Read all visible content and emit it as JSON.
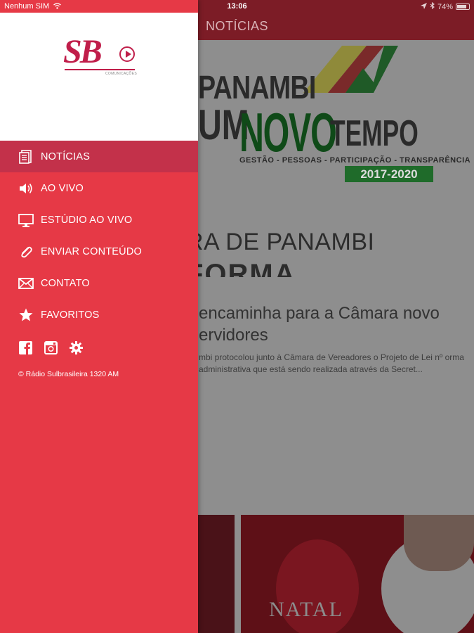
{
  "status_bar": {
    "carrier": "Nenhum SIM",
    "time": "13:06",
    "battery": "74%"
  },
  "app_bar": {
    "title": "NOTÍCIAS"
  },
  "background": {
    "banner": {
      "line1": "PANAMBI",
      "line2_a": "UM",
      "line2_b": "NOVO",
      "line2_c": "TEMPO",
      "subtitle": "GESTÃO - PESSOAS - PARTICIPAÇÃO - TRANSPARÊNCIA",
      "years": "2017-2020"
    },
    "headline_image_text": "RA DE PANAMBI",
    "headline_image_text2": "FORMA",
    "article": {
      "title": "encaminha para a Câmara novo ervidores",
      "excerpt": "mbi protocolou junto à Câmara de Vereadores o Projeto de Lei nº orma administrativa que está sendo realizada através da Secret..."
    },
    "second_image_text": "NATAL"
  },
  "drawer": {
    "logo": {
      "text": "SB",
      "subtitle": "COMUNICAÇÕES"
    },
    "menu": [
      {
        "label": "NOTÍCIAS",
        "icon": "news-icon",
        "active": true
      },
      {
        "label": "AO VIVO",
        "icon": "speaker-icon",
        "active": false
      },
      {
        "label": "ESTÚDIO AO VIVO",
        "icon": "monitor-icon",
        "active": false
      },
      {
        "label": "ENVIAR CONTEÚDO",
        "icon": "paperclip-icon",
        "active": false
      },
      {
        "label": "CONTATO",
        "icon": "envelope-icon",
        "active": false
      },
      {
        "label": "FAVORITOS",
        "icon": "star-icon",
        "active": false
      }
    ],
    "social": [
      "facebook-icon",
      "instagram-icon",
      "gear-icon"
    ],
    "copyright": "© Rádio Sulbrasileira 1320 AM"
  },
  "colors": {
    "drawer_bg": "#e63946",
    "drawer_active": "#c3314a",
    "app_bar": "#7c1c26",
    "logo": "#c01e4a"
  }
}
